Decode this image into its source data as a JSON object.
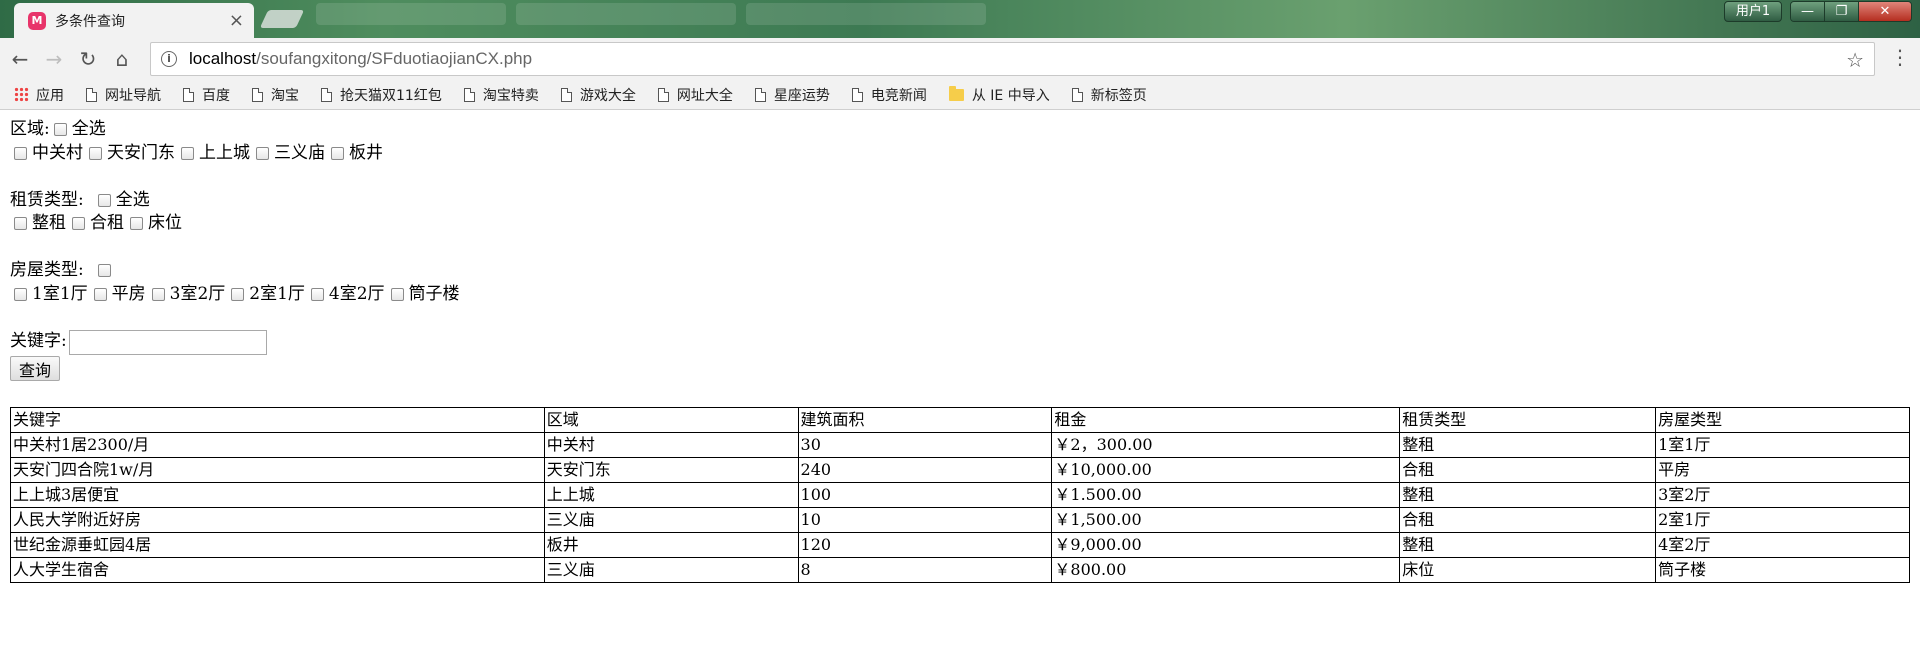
{
  "browser": {
    "tab_title": "多条件查询",
    "tab_favicon": "M",
    "tab_close": "×",
    "user_button": "用户1",
    "url_host": "localhost",
    "url_path": "/soufangxitong/SFduotiaojianCX.php"
  },
  "bookmarks": [
    {
      "label": "应用",
      "icon": "apps-icon"
    },
    {
      "label": "网址导航",
      "icon": "page-icon"
    },
    {
      "label": "百度",
      "icon": "page-icon"
    },
    {
      "label": "淘宝",
      "icon": "page-icon"
    },
    {
      "label": "抢天猫双11红包",
      "icon": "page-icon"
    },
    {
      "label": "淘宝特卖",
      "icon": "page-icon"
    },
    {
      "label": "游戏大全",
      "icon": "page-icon"
    },
    {
      "label": "网址大全",
      "icon": "page-icon"
    },
    {
      "label": "星座运势",
      "icon": "page-icon"
    },
    {
      "label": "电竞新闻",
      "icon": "page-icon"
    },
    {
      "label": "从 IE 中导入",
      "icon": "folder-icon"
    },
    {
      "label": "新标签页",
      "icon": "page-icon"
    }
  ],
  "form": {
    "area": {
      "label": "区域:",
      "select_all": "全选",
      "options": [
        "中关村",
        "天安门东",
        "上上城",
        "三义庙",
        "板井"
      ]
    },
    "rent_type": {
      "label": "租赁类型:",
      "select_all": "全选",
      "options": [
        "整租",
        "合租",
        "床位"
      ]
    },
    "house_type": {
      "label": "房屋类型:",
      "select_all": "",
      "options": [
        "1室1厅",
        "平房",
        "3室2厅",
        "2室1厅",
        "4室2厅",
        "筒子楼"
      ]
    },
    "keyword": {
      "label": "关键字:",
      "value": ""
    },
    "submit_label": "查询"
  },
  "table": {
    "headers": [
      "关键字",
      "区域",
      "建筑面积",
      "租金",
      "租赁类型",
      "房屋类型"
    ],
    "rows": [
      [
        "中关村1居2300/月",
        "中关村",
        "30",
        "￥2，300.00",
        "整租",
        "1室1厅"
      ],
      [
        "天安门四合院1w/月",
        "天安门东",
        "240",
        "￥10,000.00",
        "合租",
        "平房"
      ],
      [
        "上上城3居便宜",
        "上上城",
        "100",
        "￥1.500.00",
        "整租",
        "3室2厅"
      ],
      [
        "人民大学附近好房",
        "三义庙",
        "10",
        "￥1,500.00",
        "合租",
        "2室1厅"
      ],
      [
        "世纪金源垂虹园4居",
        "板井",
        "120",
        "￥9,000.00",
        "整租",
        "4室2厅"
      ],
      [
        "人大学生宿舍",
        "三义庙",
        "8",
        "￥800.00",
        "床位",
        "筒子楼"
      ]
    ]
  }
}
